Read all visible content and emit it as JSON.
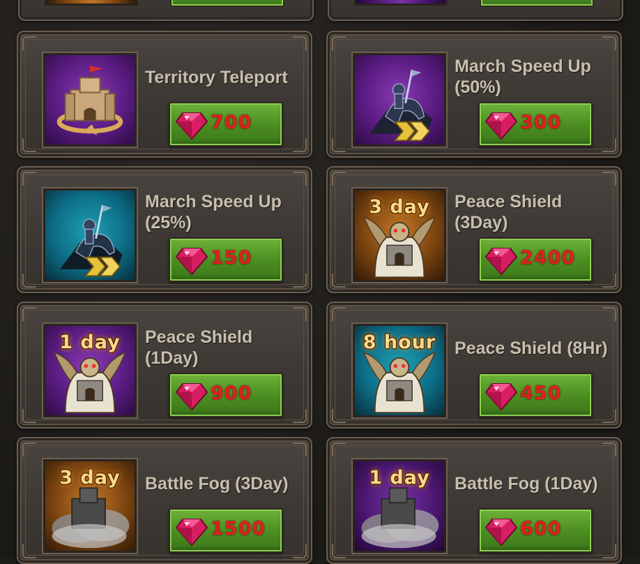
{
  "items": [
    {
      "title": "Territory Teleport",
      "price": "700",
      "duration": "",
      "bg": "purple",
      "art": "castle-teleport-icon"
    },
    {
      "title": "March Speed Up (50%)",
      "price": "300",
      "duration": "",
      "bg": "purple",
      "art": "knight-speed-icon"
    },
    {
      "title": "March Speed Up (25%)",
      "price": "150",
      "duration": "",
      "bg": "teal",
      "art": "knight-speed-icon"
    },
    {
      "title": "Peace Shield (3Day)",
      "price": "2400",
      "duration": "3 day",
      "bg": "orange",
      "art": "peace-shield-icon"
    },
    {
      "title": "Peace Shield (1Day)",
      "price": "900",
      "duration": "1 day",
      "bg": "purple",
      "art": "peace-shield-icon"
    },
    {
      "title": "Peace Shield (8Hr)",
      "price": "450",
      "duration": "8 hour",
      "bg": "teal",
      "art": "peace-shield-icon"
    },
    {
      "title": "Battle Fog (3Day)",
      "price": "1500",
      "duration": "3 day",
      "bg": "orange",
      "art": "battle-fog-icon"
    },
    {
      "title": "Battle Fog (1Day)",
      "price": "600",
      "duration": "1 day",
      "bg": "darkpurple",
      "art": "battle-fog-icon"
    }
  ],
  "colors": {
    "price": "#e02020",
    "title": "#c7bfae",
    "button": "#4d8f22",
    "duration": "#ffd88a"
  }
}
